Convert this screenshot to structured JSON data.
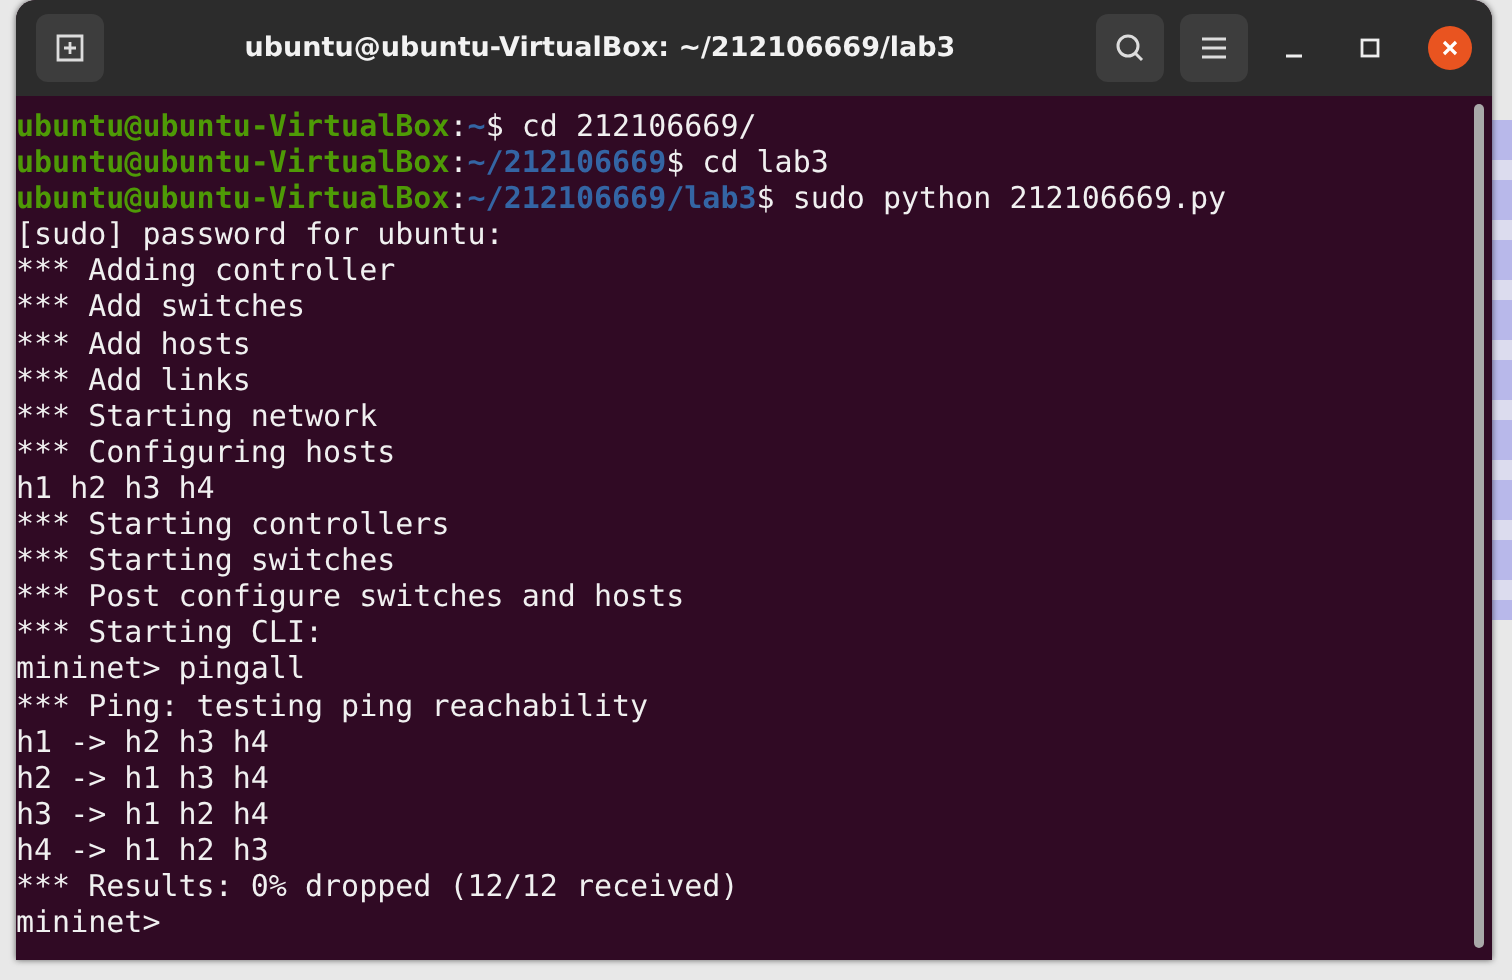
{
  "window": {
    "title": "ubuntu@ubuntu-VirtualBox: ~/212106669/lab3"
  },
  "terminal": {
    "lines": [
      [
        {
          "kind": "user",
          "text": "ubuntu@ubuntu-VirtualBox"
        },
        {
          "kind": "plain",
          "text": ":"
        },
        {
          "kind": "path",
          "text": "~"
        },
        {
          "kind": "plain",
          "text": "$ cd 212106669/"
        }
      ],
      [
        {
          "kind": "user",
          "text": "ubuntu@ubuntu-VirtualBox"
        },
        {
          "kind": "plain",
          "text": ":"
        },
        {
          "kind": "path",
          "text": "~/212106669"
        },
        {
          "kind": "plain",
          "text": "$ cd lab3"
        }
      ],
      [
        {
          "kind": "user",
          "text": "ubuntu@ubuntu-VirtualBox"
        },
        {
          "kind": "plain",
          "text": ":"
        },
        {
          "kind": "path",
          "text": "~/212106669/lab3"
        },
        {
          "kind": "plain",
          "text": "$ sudo python 212106669.py"
        }
      ],
      [
        {
          "kind": "plain",
          "text": "[sudo] password for ubuntu:"
        }
      ],
      [
        {
          "kind": "plain",
          "text": "*** Adding controller"
        }
      ],
      [
        {
          "kind": "plain",
          "text": "*** Add switches"
        }
      ],
      [
        {
          "kind": "plain",
          "text": "*** Add hosts"
        }
      ],
      [
        {
          "kind": "plain",
          "text": "*** Add links"
        }
      ],
      [
        {
          "kind": "plain",
          "text": "*** Starting network"
        }
      ],
      [
        {
          "kind": "plain",
          "text": "*** Configuring hosts"
        }
      ],
      [
        {
          "kind": "plain",
          "text": "h1 h2 h3 h4"
        }
      ],
      [
        {
          "kind": "plain",
          "text": "*** Starting controllers"
        }
      ],
      [
        {
          "kind": "plain",
          "text": "*** Starting switches"
        }
      ],
      [
        {
          "kind": "plain",
          "text": "*** Post configure switches and hosts"
        }
      ],
      [
        {
          "kind": "plain",
          "text": "*** Starting CLI:"
        }
      ],
      [
        {
          "kind": "plain",
          "text": "mininet> pingall"
        }
      ],
      [
        {
          "kind": "plain",
          "text": "*** Ping: testing ping reachability"
        }
      ],
      [
        {
          "kind": "plain",
          "text": "h1 -> h2 h3 h4"
        }
      ],
      [
        {
          "kind": "plain",
          "text": "h2 -> h1 h3 h4"
        }
      ],
      [
        {
          "kind": "plain",
          "text": "h3 -> h1 h2 h4"
        }
      ],
      [
        {
          "kind": "plain",
          "text": "h4 -> h1 h2 h3"
        }
      ],
      [
        {
          "kind": "plain",
          "text": "*** Results: 0% dropped (12/12 received)"
        }
      ],
      [
        {
          "kind": "plain",
          "text": "mininet>"
        }
      ]
    ]
  }
}
